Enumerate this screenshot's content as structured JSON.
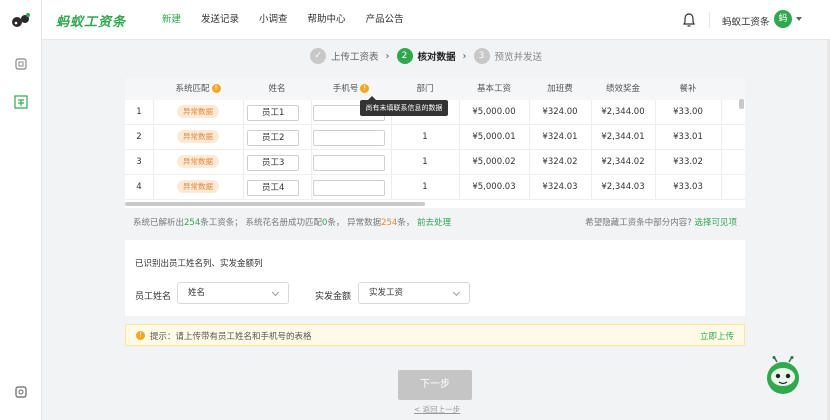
{
  "header": {
    "brand": "蚂蚁工资条",
    "menu": [
      {
        "label": "新建",
        "active": true
      },
      {
        "label": "发送记录",
        "active": false
      },
      {
        "label": "小调查",
        "active": false
      },
      {
        "label": "帮助中心",
        "active": false
      },
      {
        "label": "产品公告",
        "active": false
      }
    ],
    "user_name": "蚂蚁工资条",
    "avatar_text": "蚂",
    "icons": [
      "bell-icon",
      "chevron-down-icon"
    ]
  },
  "rail": {
    "icons": [
      "ant-logo-icon",
      "document-icon",
      "payslip-icon",
      "settings-icon"
    ]
  },
  "steps": [
    {
      "num": "✓",
      "label": "上传工资表",
      "state": "done"
    },
    {
      "num": "2",
      "label": "核对数据",
      "state": "current"
    },
    {
      "num": "3",
      "label": "预览并发送",
      "state": "pending"
    }
  ],
  "table": {
    "columns": [
      "",
      "系统匹配",
      "姓名",
      "手机号",
      "部门",
      "基本工资",
      "加班费",
      "绩效奖金",
      "餐补"
    ],
    "rows": [
      {
        "idx": "1",
        "match": "异常数据",
        "name": "员工1",
        "phone": "",
        "dept": "",
        "base": "¥5,000.00",
        "overtime": "¥324.00",
        "bonus": "¥2,344.00",
        "meal": "¥33.00"
      },
      {
        "idx": "2",
        "match": "异常数据",
        "name": "员工2",
        "phone": "",
        "dept": "1",
        "base": "¥5,000.01",
        "overtime": "¥324.01",
        "bonus": "¥2,344.01",
        "meal": "¥33.01"
      },
      {
        "idx": "3",
        "match": "异常数据",
        "name": "员工3",
        "phone": "",
        "dept": "1",
        "base": "¥5,000.02",
        "overtime": "¥324.02",
        "bonus": "¥2,344.02",
        "meal": "¥33.02"
      },
      {
        "idx": "4",
        "match": "异常数据",
        "name": "员工4",
        "phone": "",
        "dept": "1",
        "base": "¥5,000.03",
        "overtime": "¥324.03",
        "bonus": "¥2,344.03",
        "meal": "¥33.03"
      }
    ],
    "tooltip": "尚有未填联系信息的数据"
  },
  "summary": {
    "p1": "系统已解析出",
    "parsed": "254",
    "p2": "条工资条；  系统花名册成功匹配",
    "matched": "0",
    "p3": "条，  异常数据",
    "abnormal": "254",
    "p4": "条，",
    "go_fix": "前去处理",
    "hide_question": "希望隐藏工资条中部分内容?",
    "choose_visible": "选择可见项"
  },
  "mapping": {
    "title": "已识别出员工姓名列、实发金额列",
    "name_label": "员工姓名",
    "name_value": "姓名",
    "amount_label": "实发金额",
    "amount_value": "实发工资"
  },
  "tip": {
    "text": "提示：请上传带有员工姓名和手机号的表格",
    "link": "立即上传"
  },
  "footer": {
    "next": "下一步",
    "back": "< 返回上一步"
  },
  "colors": {
    "brand_green": "#2fa84f",
    "warning_orange": "#e08a3c",
    "disabled_gray": "#c5c5c5"
  }
}
